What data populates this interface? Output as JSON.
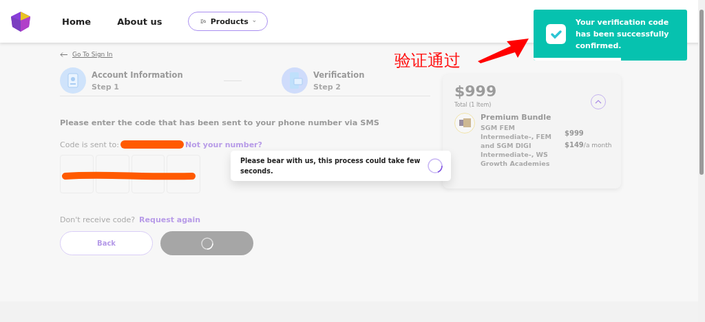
{
  "nav": {
    "items": [
      "Home",
      "About us"
    ],
    "products_button": "Products"
  },
  "back_link": "Go To Sign In",
  "steps": [
    {
      "title": "Account Information",
      "subtitle": "Step 1",
      "kind": "account"
    },
    {
      "title": "Verification",
      "subtitle": "Step 2",
      "kind": "phone"
    }
  ],
  "instruction": "Please enter the code that has been sent to your phone number via SMS",
  "sent_to_label": "Code is sent to:",
  "not_your_number": "Not your number?",
  "resend": {
    "label": "Don't receive code?",
    "link": "Request again"
  },
  "buttons": {
    "back": "Back",
    "verify_loading": true
  },
  "summary": {
    "total": "$999",
    "total_label": "Total (1 Item)",
    "expanded": true,
    "item": {
      "name": "Premium Bundle",
      "description": "SGM FEM Intermediate-, FEM and SGM DIGI Intermediate-, WS Growth Academies",
      "price": "$999",
      "monthly": "$149",
      "monthly_unit": "/a month"
    }
  },
  "loading_popup": {
    "message": "Please bear with us, this process could take few seconds."
  },
  "toast": {
    "message": "Your verification code has been successfully confirmed.",
    "level": 0.57
  },
  "annotation": {
    "text": "验证通过"
  }
}
